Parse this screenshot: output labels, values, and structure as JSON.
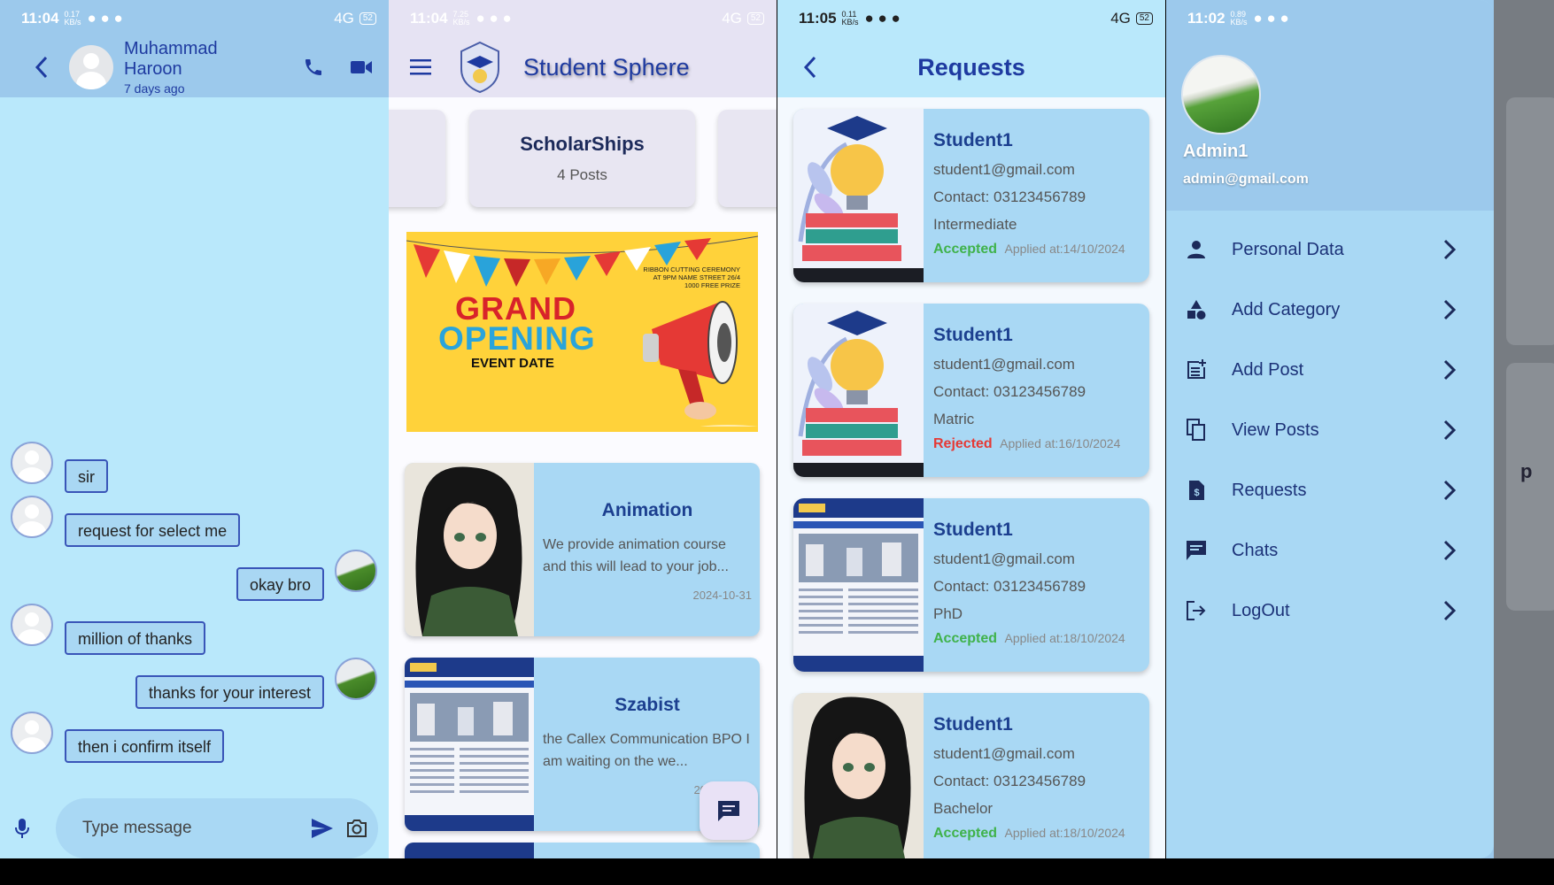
{
  "status_bars": {
    "p1": {
      "time": "11:04",
      "speed": "0.17 KB/s",
      "network": "4G",
      "battery": "52"
    },
    "p2": {
      "time": "11:04",
      "speed": "7.25 KB/s",
      "network": "4G",
      "battery": "52"
    },
    "p3": {
      "time": "11:05",
      "speed": "0.11 KB/s",
      "network": "4G",
      "battery": "52"
    },
    "p4": {
      "time": "11:02",
      "speed": "0.89 KB/s",
      "network": "4G",
      "battery": "52"
    }
  },
  "chat": {
    "contact_name": "Muhammad Haroon",
    "last_seen": "7 days ago",
    "messages": [
      {
        "text": "sir",
        "from": "other"
      },
      {
        "text": "request for select me",
        "from": "other"
      },
      {
        "text": "okay bro",
        "from": "self"
      },
      {
        "text": "million of thanks",
        "from": "other"
      },
      {
        "text": "thanks for your interest",
        "from": "self"
      },
      {
        "text": "then i confirm itself",
        "from": "other"
      }
    ],
    "input_placeholder": "Type message"
  },
  "home": {
    "app_title": "Student Sphere",
    "category": {
      "name": "ScholarShips",
      "count": "4 Posts"
    },
    "banner": {
      "line1": "GRAND",
      "line2": "OPENING",
      "line3": "EVENT DATE",
      "info": "RIBBON CUTTING CEREMONY AT 9PM NAME STREET 26/4 1000 FREE PRIZE"
    },
    "posts": [
      {
        "title": "Animation",
        "description": "We provide animation course and this will lead to your job...",
        "date": "2024-10-31"
      },
      {
        "title": "Szabist",
        "description": "the Callex Communication BPO I am waiting on the we...",
        "date": "2024-11-30"
      }
    ]
  },
  "requests": {
    "title": "Requests",
    "items": [
      {
        "name": "Student1",
        "email": "student1@gmail.com",
        "contact": "Contact: 03123456789",
        "level": "Intermediate",
        "status": "Accepted",
        "applied": "Applied at:14/10/2024"
      },
      {
        "name": "Student1",
        "email": "student1@gmail.com",
        "contact": "Contact: 03123456789",
        "level": "Matric",
        "status": "Rejected",
        "applied": "Applied at:16/10/2024"
      },
      {
        "name": "Student1",
        "email": "student1@gmail.com",
        "contact": "Contact: 03123456789",
        "level": "PhD",
        "status": "Accepted",
        "applied": "Applied at:18/10/2024"
      },
      {
        "name": "Student1",
        "email": "student1@gmail.com",
        "contact": "Contact: 03123456789",
        "level": "Bachelor",
        "status": "Accepted",
        "applied": "Applied at:18/10/2024"
      }
    ],
    "colors": {
      "accepted": "#3fb24a",
      "rejected": "#e53935"
    }
  },
  "drawer": {
    "user_name": "Admin1",
    "user_email": "admin@gmail.com",
    "items": [
      {
        "label": "Personal Data",
        "icon": "person-icon"
      },
      {
        "label": "Add Category",
        "icon": "category-icon"
      },
      {
        "label": "Add Post",
        "icon": "post-add-icon"
      },
      {
        "label": "View Posts",
        "icon": "copy-icon"
      },
      {
        "label": "Requests",
        "icon": "request-icon"
      },
      {
        "label": "Chats",
        "icon": "chat-icon"
      },
      {
        "label": "LogOut",
        "icon": "logout-icon"
      }
    ]
  },
  "colors": {
    "accent": "#1e3aa0",
    "chat_bg": "#b9e8fb",
    "card_bg": "#a9d8f4",
    "header_bg": "#9cc9ec"
  }
}
